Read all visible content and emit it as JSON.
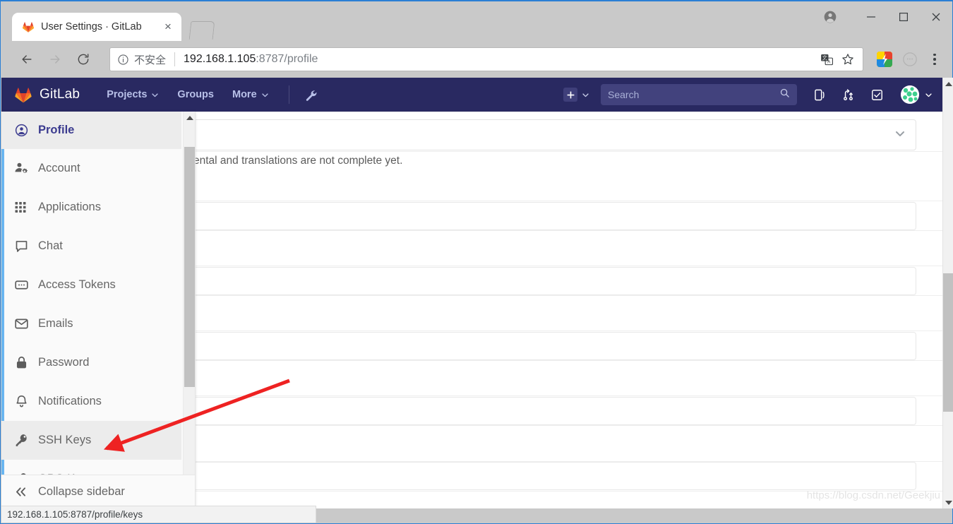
{
  "browser": {
    "tab": {
      "title": "User Settings · GitLab",
      "favicon": "gitlab-favicon",
      "close_label": "×"
    },
    "new_tab_label": "+",
    "nav": {
      "back": "←",
      "forward": "→",
      "reload": "⟳"
    },
    "omnibox": {
      "security_label": "不安全",
      "url_host": "192.168.1.105",
      "url_rest": ":8787/profile",
      "translate_icon": "translate-icon",
      "bookmark_icon": "star-icon"
    },
    "extension_icon": "extension-icon",
    "account_icon": "account-circle-icon",
    "menu_icon": "three-dot-menu-icon",
    "window": {
      "minimize": "—",
      "maximize": "□",
      "close": "✕"
    }
  },
  "gitlab": {
    "brand": "GitLab",
    "nav_links": [
      {
        "label": "Projects",
        "has_caret": true
      },
      {
        "label": "Groups",
        "has_caret": false
      },
      {
        "label": "More",
        "has_caret": true
      }
    ],
    "admin_icon": "wrench-icon",
    "new_icon": "plus-icon",
    "search": {
      "placeholder": "Search",
      "icon": "search-icon"
    },
    "right_icons": [
      {
        "name": "issues-icon"
      },
      {
        "name": "merge-requests-icon"
      },
      {
        "name": "todos-icon"
      }
    ],
    "avatar": "user-avatar"
  },
  "sidebar": {
    "items": [
      {
        "label": "Profile",
        "icon": "user-circle-icon",
        "state": "active"
      },
      {
        "label": "Account",
        "icon": "user-gear-icon",
        "state": "normal"
      },
      {
        "label": "Applications",
        "icon": "grid-apps-icon",
        "state": "normal"
      },
      {
        "label": "Chat",
        "icon": "chat-bubble-icon",
        "state": "normal"
      },
      {
        "label": "Access Tokens",
        "icon": "token-icon",
        "state": "normal"
      },
      {
        "label": "Emails",
        "icon": "envelope-icon",
        "state": "normal"
      },
      {
        "label": "Password",
        "icon": "lock-icon",
        "state": "normal"
      },
      {
        "label": "Notifications",
        "icon": "bell-icon",
        "state": "normal"
      },
      {
        "label": "SSH Keys",
        "icon": "key-icon",
        "state": "hovered"
      },
      {
        "label": "GPG Keys",
        "icon": "key-icon",
        "state": "normal"
      }
    ],
    "footer": {
      "label": "Collapse sidebar",
      "icon": "double-chevron-left-icon"
    }
  },
  "content": {
    "note": "ental and translations are not complete yet.",
    "select_caret_icon": "chevron-down-icon",
    "field_count": 5
  },
  "status_bar": {
    "url": "192.168.1.105:8787/profile/keys"
  },
  "watermark": {
    "text": "https://blog.csdn.net/Geekjiu"
  },
  "annotation": {
    "type": "red-arrow",
    "points_to": "SSH Keys"
  },
  "colors": {
    "gitlab_navy": "#292961",
    "sidebar_active_text": "#3b3b8f",
    "accent_blue": "#6ab6f0",
    "annotation_red": "#ee2222"
  }
}
